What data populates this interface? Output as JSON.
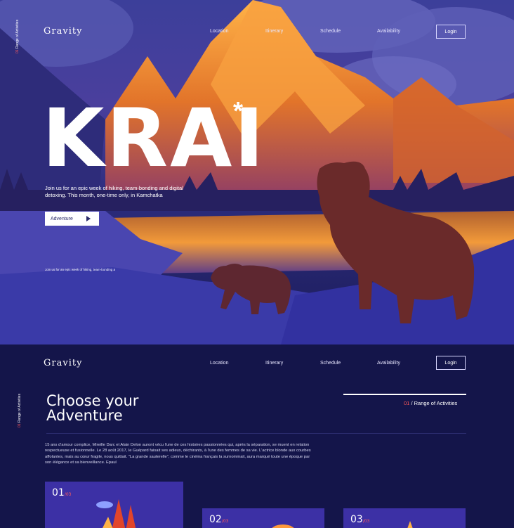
{
  "nav": {
    "logo": "Gravity",
    "items": [
      "Location",
      "Itinerary",
      "Schedule",
      "Availability"
    ],
    "login": "Login"
  },
  "hero": {
    "side_num": "01",
    "side_label": "Range of Activities",
    "title": "KRAI",
    "asterisk": "*",
    "description": "Join us for an epic week of hiking, team-bonding and digital detoxing. This month, one-time only, in Kamchatka",
    "button": "Adventure",
    "small_caption": "Join us for an epic week of hiking, team-bonding a"
  },
  "section": {
    "side_num": "01",
    "side_label": "Range of Activities",
    "title_line1": "Choose your",
    "title_line2": "Adventure",
    "range_num": "01",
    "range_text": "/ Range of Activities",
    "paragraph": "15 ans d'amour complice, Mireille Darc et Alain Delon auront vécu l'une de ces histoires passionnées qui, après la séparation, se muent en relation respectueuse et fusionnelle. Le 28 août 2017, le Guépard faisait ses adieux, déchirants, à l'une des femmes de sa vie. L'actrice blonde aux courbes affolantes, mais au cœur fragile, nous quittait. \"La grande sauterelle\", comme le cinéma français la surnommait, aura marqué toute une époque par son élégance et sa bienveillance. Epaul",
    "cards": [
      {
        "num": "01",
        "total": "/03"
      },
      {
        "num": "02",
        "total": "/03"
      },
      {
        "num": "03",
        "total": "/03"
      }
    ]
  },
  "colors": {
    "accent": "#ff5a5a",
    "background": "#14154a",
    "card": "#3c30a5",
    "mountain_orange": "#f0892e"
  }
}
